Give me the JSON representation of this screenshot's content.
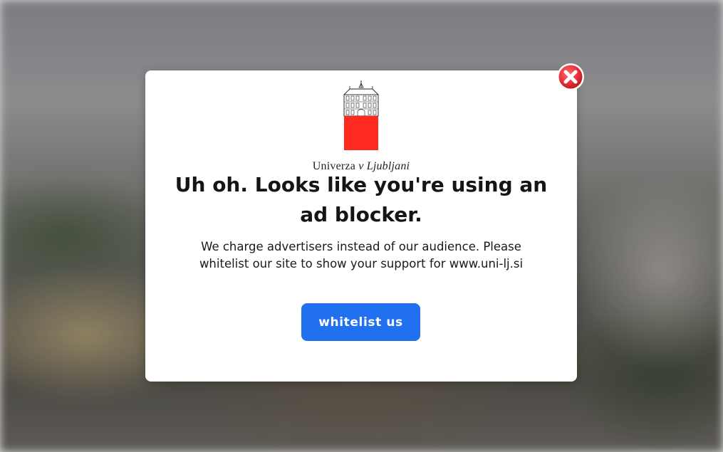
{
  "overlay": {
    "logo": {
      "name_regular": "Univerza ",
      "name_italic": "v Ljubljani",
      "colors": {
        "building": "#222222",
        "shield_red": "#ff2a1f"
      }
    },
    "title": "Uh oh. Looks like you're using an ad blocker.",
    "message": "We charge advertisers instead of our audience. Please whitelist our site to show your support for www.uni-lj.si",
    "cta_label": "whitelist us",
    "close_icon": "close-x-circle-icon",
    "colors": {
      "accent": "#2070f0",
      "close": "#e8313a"
    }
  }
}
